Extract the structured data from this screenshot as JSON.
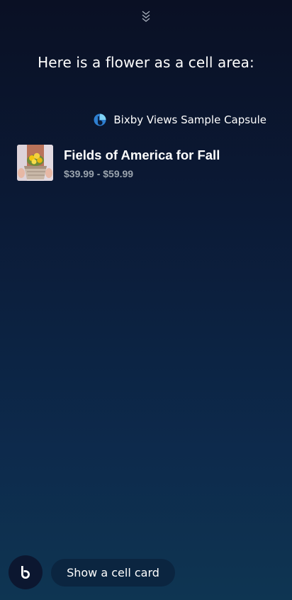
{
  "header": {
    "collapse_icon": "double-chevron-down-icon",
    "headline": "Here is a flower as a cell area:"
  },
  "capsule": {
    "logo_icon": "bixby-logo-icon",
    "name": "Bixby Views Sample Capsule"
  },
  "cell_card": {
    "thumbnail": "flower-basket-image",
    "title": "Fields of America for Fall",
    "price_range": "$39.99 - $59.99"
  },
  "footer": {
    "bixby_icon": "bixby-icon",
    "utterance": "Show a cell card"
  },
  "colors": {
    "background_top": "#0a1024",
    "background_bottom": "#0e3552",
    "price_text": "#9aa3ad",
    "chip_bg": "#0b2540",
    "bixby_blue": "#3aa0e6"
  }
}
